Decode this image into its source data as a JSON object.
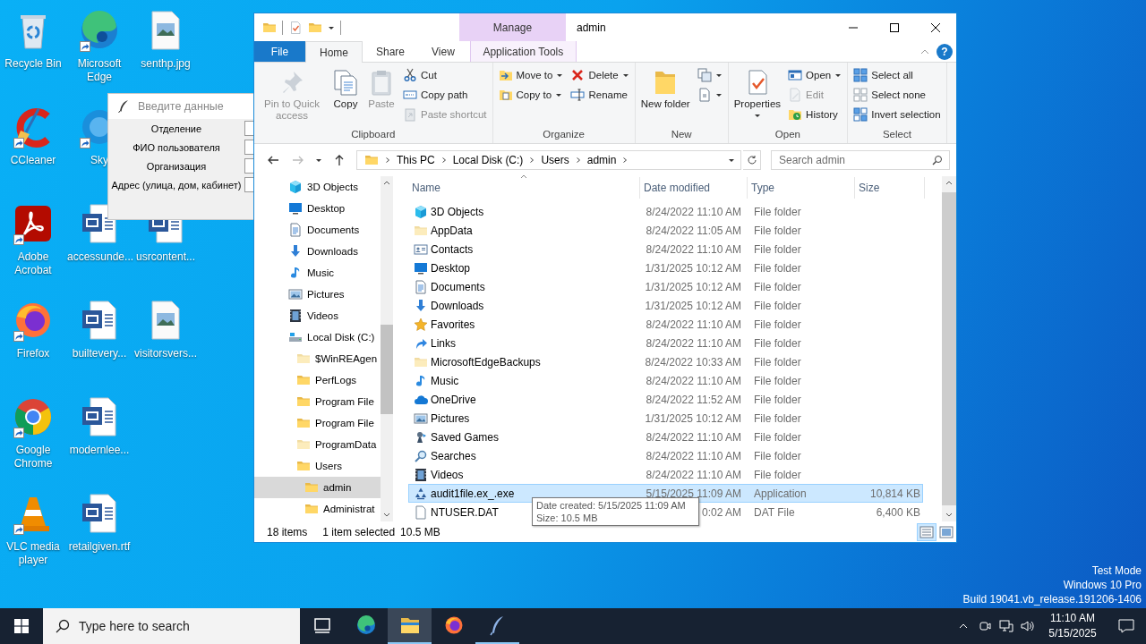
{
  "desktop_icons": [
    [
      {
        "label": "Recycle Bin",
        "kind": "recycle",
        "shortcut": false
      },
      {
        "label": "Microsoft Edge",
        "kind": "edge",
        "shortcut": true
      },
      {
        "label": "senthp.jpg",
        "kind": "image",
        "shortcut": false
      }
    ],
    [
      {
        "label": "CCleaner",
        "kind": "ccleaner",
        "shortcut": true
      },
      {
        "label": "Sky",
        "kind": "skype",
        "shortcut": true
      }
    ],
    [
      {
        "label": "Adobe Acrobat",
        "kind": "acrobat",
        "shortcut": true
      },
      {
        "label": "accessunde...",
        "kind": "word",
        "shortcut": false
      },
      {
        "label": "usrcontent...",
        "kind": "word",
        "shortcut": false
      }
    ],
    [
      {
        "label": "Firefox",
        "kind": "firefox",
        "shortcut": true
      },
      {
        "label": "builtevery...",
        "kind": "word",
        "shortcut": false
      },
      {
        "label": "visitorsvers...",
        "kind": "image",
        "shortcut": false
      }
    ],
    [
      {
        "label": "Google Chrome",
        "kind": "chrome",
        "shortcut": true
      },
      {
        "label": "modernlee...",
        "kind": "word",
        "shortcut": false
      }
    ],
    [
      {
        "label": "VLC media player",
        "kind": "vlc",
        "shortcut": true
      },
      {
        "label": "retailgiven.rtf",
        "kind": "word",
        "shortcut": false
      }
    ]
  ],
  "dialog": {
    "title": "Введите данные",
    "fields": [
      {
        "label": "Отделение"
      },
      {
        "label": "ФИО пользователя"
      },
      {
        "label": "Организация"
      },
      {
        "label": "Адрес (улица, дом, кабинет)"
      }
    ]
  },
  "explorer": {
    "title": "admin",
    "context_header": "Manage",
    "tabs": [
      {
        "label": "File",
        "kind": "file",
        "selected": false
      },
      {
        "label": "Home",
        "kind": "normal",
        "selected": true
      },
      {
        "label": "Share",
        "kind": "normal",
        "selected": false
      },
      {
        "label": "View",
        "kind": "normal",
        "selected": false
      },
      {
        "label": "Application Tools",
        "kind": "contextual",
        "selected": false
      }
    ],
    "help": "?",
    "ribbon": [
      {
        "label": "Clipboard",
        "columns": [
          {
            "kind": "large",
            "buttons": [
              {
                "label": "Pin to Quick access",
                "kind": "pin",
                "disabled": true,
                "dropdown": false
              }
            ]
          },
          {
            "kind": "large",
            "buttons": [
              {
                "label": "Copy",
                "kind": "copy",
                "disabled": false,
                "dropdown": false
              }
            ]
          },
          {
            "kind": "large",
            "buttons": [
              {
                "label": "Paste",
                "kind": "paste",
                "disabled": true,
                "dropdown": false
              }
            ]
          },
          {
            "kind": "small",
            "buttons": [
              {
                "label": "Cut",
                "kind": "cut",
                "disabled": false,
                "dropdown": false
              },
              {
                "label": "Copy path",
                "kind": "copypath",
                "disabled": false,
                "dropdown": false
              },
              {
                "label": "Paste shortcut",
                "kind": "pasteshortcut",
                "disabled": true,
                "dropdown": false
              }
            ]
          }
        ]
      },
      {
        "label": "Organize",
        "columns": [
          {
            "kind": "small",
            "buttons": [
              {
                "label": "Move to",
                "kind": "moveto",
                "disabled": false,
                "dropdown": true
              },
              {
                "label": "Copy to",
                "kind": "copyto",
                "disabled": false,
                "dropdown": true
              }
            ]
          },
          {
            "kind": "small",
            "buttons": [
              {
                "label": "Delete",
                "kind": "delete",
                "disabled": false,
                "dropdown": true
              },
              {
                "label": "Rename",
                "kind": "rename",
                "disabled": false,
                "dropdown": false
              }
            ]
          }
        ]
      },
      {
        "label": "New",
        "columns": [
          {
            "kind": "large",
            "buttons": [
              {
                "label": "New folder",
                "kind": "newfolder",
                "disabled": false,
                "dropdown": false
              }
            ]
          },
          {
            "kind": "small",
            "buttons": [
              {
                "kind": "newitem",
                "disabled": false,
                "dropdown": true
              },
              {
                "kind": "easyaccess",
                "disabled": false,
                "dropdown": true
              }
            ]
          }
        ]
      },
      {
        "label": "Open",
        "columns": [
          {
            "kind": "large",
            "buttons": [
              {
                "label": "Properties",
                "kind": "properties",
                "disabled": false,
                "dropdown": true
              }
            ]
          },
          {
            "kind": "small",
            "buttons": [
              {
                "label": "Open",
                "kind": "open",
                "disabled": false,
                "dropdown": true
              },
              {
                "label": "Edit",
                "kind": "edit",
                "disabled": true,
                "dropdown": false
              },
              {
                "label": "History",
                "kind": "history",
                "disabled": false,
                "dropdown": false
              }
            ]
          }
        ]
      },
      {
        "label": "Select",
        "columns": [
          {
            "kind": "small",
            "buttons": [
              {
                "label": "Select all",
                "kind": "selectall",
                "disabled": false,
                "dropdown": false
              },
              {
                "label": "Select none",
                "kind": "selectnone",
                "disabled": false,
                "dropdown": false
              },
              {
                "label": "Invert selection",
                "kind": "invert",
                "disabled": false,
                "dropdown": false
              }
            ]
          }
        ]
      }
    ],
    "address": {
      "crumbs": [
        "This PC",
        "Local Disk (C:)",
        "Users",
        "admin"
      ],
      "search_placeholder": "Search admin"
    },
    "nav": [
      {
        "label": "3D Objects",
        "kind": "cube",
        "selected": false
      },
      {
        "label": "Desktop",
        "kind": "desktop",
        "selected": false
      },
      {
        "label": "Documents",
        "kind": "documents",
        "selected": false
      },
      {
        "label": "Downloads",
        "kind": "downloads",
        "selected": false
      },
      {
        "label": "Music",
        "kind": "music",
        "selected": false
      },
      {
        "label": "Pictures",
        "kind": "pictures",
        "selected": false
      },
      {
        "label": "Videos",
        "kind": "videos",
        "selected": false
      },
      {
        "label": "Local Disk (C:)",
        "kind": "drive",
        "selected": false,
        "children": [
          {
            "label": "$WinREAgen",
            "kind": "hfolder",
            "selected": false
          },
          {
            "label": "PerfLogs",
            "kind": "folder",
            "selected": false
          },
          {
            "label": "Program File",
            "kind": "folder",
            "selected": false
          },
          {
            "label": "Program File",
            "kind": "folder",
            "selected": false
          },
          {
            "label": "ProgramData",
            "kind": "hfolder",
            "selected": false
          },
          {
            "label": "Users",
            "kind": "folder",
            "selected": false,
            "children": [
              {
                "label": "admin",
                "kind": "folder",
                "selected": true
              },
              {
                "label": "Administrat",
                "kind": "folder",
                "selected": false
              }
            ]
          }
        ]
      }
    ],
    "columns": [
      "Name",
      "Date modified",
      "Type",
      "Size"
    ],
    "rows": [
      {
        "name": "3D Objects",
        "kind": "cube",
        "date": "8/24/2022 11:10 AM",
        "type": "File folder",
        "selected": false
      },
      {
        "name": "AppData",
        "kind": "hfolder",
        "date": "8/24/2022 11:05 AM",
        "type": "File folder",
        "selected": false
      },
      {
        "name": "Contacts",
        "kind": "contacts",
        "date": "8/24/2022 11:10 AM",
        "type": "File folder",
        "selected": false
      },
      {
        "name": "Desktop",
        "kind": "desktop",
        "date": "1/31/2025 10:12 AM",
        "type": "File folder",
        "selected": false
      },
      {
        "name": "Documents",
        "kind": "documents",
        "date": "1/31/2025 10:12 AM",
        "type": "File folder",
        "selected": false
      },
      {
        "name": "Downloads",
        "kind": "downloads",
        "date": "1/31/2025 10:12 AM",
        "type": "File folder",
        "selected": false
      },
      {
        "name": "Favorites",
        "kind": "star",
        "date": "8/24/2022 11:10 AM",
        "type": "File folder",
        "selected": false
      },
      {
        "name": "Links",
        "kind": "links",
        "date": "8/24/2022 11:10 AM",
        "type": "File folder",
        "selected": false
      },
      {
        "name": "MicrosoftEdgeBackups",
        "kind": "hfolder",
        "date": "8/24/2022 10:33 AM",
        "type": "File folder",
        "selected": false
      },
      {
        "name": "Music",
        "kind": "music",
        "date": "8/24/2022 11:10 AM",
        "type": "File folder",
        "selected": false
      },
      {
        "name": "OneDrive",
        "kind": "cloud",
        "date": "8/24/2022 11:52 AM",
        "type": "File folder",
        "selected": false
      },
      {
        "name": "Pictures",
        "kind": "pictures",
        "date": "1/31/2025 10:12 AM",
        "type": "File folder",
        "selected": false
      },
      {
        "name": "Saved Games",
        "kind": "games",
        "date": "8/24/2022 11:10 AM",
        "type": "File folder",
        "selected": false
      },
      {
        "name": "Searches",
        "kind": "searches",
        "date": "8/24/2022 11:10 AM",
        "type": "File folder",
        "selected": false
      },
      {
        "name": "Videos",
        "kind": "videos",
        "date": "8/24/2022 11:10 AM",
        "type": "File folder",
        "selected": false
      },
      {
        "name": "audit1file.ex_.exe",
        "kind": "app",
        "date": "5/15/2025 11:09 AM",
        "type": "Application",
        "size": "10,814 KB",
        "selected": true
      },
      {
        "name": "NTUSER.DAT",
        "kind": "file",
        "date": "0:02 AM",
        "type": "DAT File",
        "size": "6,400 KB",
        "selected": false
      }
    ],
    "tooltip": [
      "Date created: 5/15/2025 11:09 AM",
      "Size: 10.5 MB"
    ],
    "status": {
      "count": "18 items",
      "selection": "1 item selected",
      "size": "10.5 MB",
      "views": [
        {
          "kind": "details",
          "selected": true
        },
        {
          "kind": "tiles",
          "selected": false
        }
      ]
    }
  },
  "desktop_notice": [
    "Test Mode",
    "Windows 10 Pro",
    "Build 19041.vb_release.191206-1406"
  ],
  "taskbar": {
    "search_placeholder": "Type here to search",
    "apps": [
      {
        "kind": "taskview",
        "selected": false,
        "open": false
      },
      {
        "kind": "edge",
        "selected": false,
        "open": false
      },
      {
        "kind": "explorer",
        "selected": true,
        "open": true
      },
      {
        "kind": "firefox",
        "selected": false,
        "open": false
      },
      {
        "kind": "feather",
        "selected": false,
        "open": true
      }
    ],
    "time": "11:10 AM",
    "date": "5/15/2025"
  }
}
